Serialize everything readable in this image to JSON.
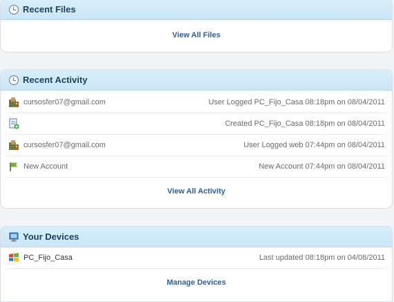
{
  "recent_files": {
    "title": "Recent Files",
    "footer_link": "View All Files"
  },
  "recent_activity": {
    "title": "Recent Activity",
    "rows": [
      {
        "icon": "user-login-icon",
        "user": "cursosfer07@gmail.com",
        "event": "User Logged PC_Fijo_Casa 08:18pm on 08/04/2011"
      },
      {
        "icon": "file-created-icon",
        "user": "",
        "event": "Created PC_Fijo_Casa 08:18pm on 08/04/2011"
      },
      {
        "icon": "user-login-icon",
        "user": "cursosfer07@gmail.com",
        "event": "User Logged web 07:44pm on 08/04/2011"
      },
      {
        "icon": "flag-icon",
        "user": "New Account",
        "event": "New Account 07:44pm on 08/04/2011"
      }
    ],
    "footer_link": "View All Activity"
  },
  "your_devices": {
    "title": "Your Devices",
    "devices": [
      {
        "icon": "windows-logo-icon",
        "name": "PC_Fijo_Casa",
        "updated": "Last updated 08:18pm on 04/08/2011"
      }
    ],
    "footer_link": "Manage Devices"
  }
}
